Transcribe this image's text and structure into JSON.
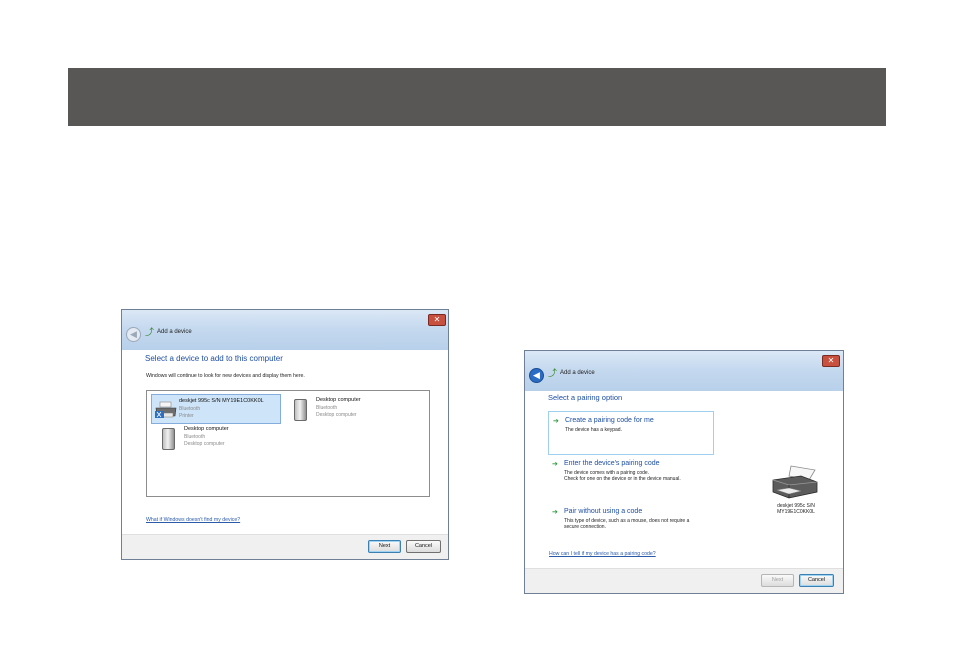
{
  "dialog1": {
    "window_title": "Add a device",
    "heading": "Select a device to add to this computer",
    "subtext": "Windows will continue to look for new devices and display them here.",
    "devices": [
      {
        "name": "deskjet 995c S/N MY19E1C0KK0L",
        "type": "Bluetooth",
        "category": "Printer",
        "icon": "printer-icon",
        "selected": true
      },
      {
        "name": "Desktop computer",
        "type": "Bluetooth",
        "category": "Desktop computer",
        "icon": "computer-icon",
        "selected": false
      },
      {
        "name": "Desktop computer",
        "type": "Bluetooth",
        "category": "Desktop computer",
        "icon": "computer-icon",
        "selected": false
      }
    ],
    "help_link": "What if Windows doesn't find my device?",
    "next_label": "Next",
    "cancel_label": "Cancel",
    "close_glyph": "✕",
    "back_glyph": "◀"
  },
  "dialog2": {
    "window_title": "Add a device",
    "heading": "Select a pairing option",
    "options": [
      {
        "title": "Create a pairing code for me",
        "desc1": "The device has a keypad.",
        "desc2": ""
      },
      {
        "title": "Enter the device's pairing code",
        "desc1": "The device comes with a pairing code.",
        "desc2": "Check for one on the device or in the device manual."
      },
      {
        "title": "Pair without using a code",
        "desc1": "This type of device, such as a mouse, does not require a",
        "desc2": "secure connection."
      }
    ],
    "device_caption_line1": "deskjet 995c S/N",
    "device_caption_line2": "MY19E1C0KK0L",
    "help_link": "How can I tell if my device has a pairing code?",
    "next_label": "Next",
    "cancel_label": "Cancel",
    "close_glyph": "✕",
    "back_glyph": "◀",
    "arrow_glyph": "➔"
  },
  "colors": {
    "banner": "#585755",
    "heading_blue": "#1e4fa2",
    "link_blue": "#2a5aa8",
    "selection": "#cde4f9",
    "arrow_green": "#2e9a3c"
  }
}
